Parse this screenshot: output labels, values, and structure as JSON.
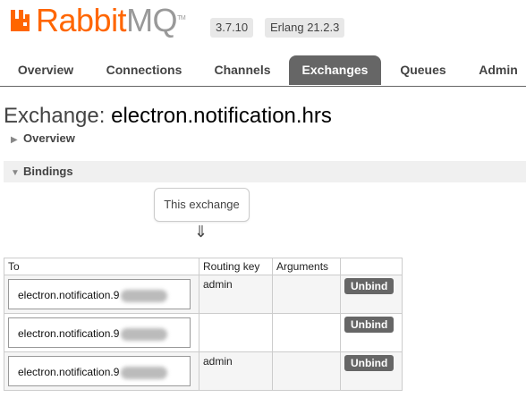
{
  "header": {
    "logo_word_rabbit": "Rabbit",
    "logo_word_mq": "MQ",
    "logo_tm": "TM",
    "version": "3.7.10",
    "erlang": "Erlang 21.2.3"
  },
  "nav": {
    "tabs": [
      "Overview",
      "Connections",
      "Channels",
      "Exchanges",
      "Queues",
      "Admin"
    ],
    "active": "Exchanges"
  },
  "page": {
    "title_prefix": "Exchange:",
    "exchange_name": "electron.notification.hrs"
  },
  "sections": {
    "overview": "Overview",
    "bindings": "Bindings"
  },
  "bindings": {
    "this_exchange": "This exchange",
    "arrow": "⇓",
    "columns": [
      "To",
      "Routing key",
      "Arguments",
      ""
    ],
    "rows": [
      {
        "to": "electron.notification.9",
        "routing_key": "admin",
        "arguments": "",
        "action": "Unbind"
      },
      {
        "to": "electron.notification.9",
        "routing_key": "",
        "arguments": "",
        "action": "Unbind"
      },
      {
        "to": "electron.notification.9",
        "routing_key": "admin",
        "arguments": "",
        "action": "Unbind"
      }
    ]
  },
  "colors": {
    "brand_orange": "#ff6600",
    "tab_active_bg": "#666666",
    "button_bg": "#666666"
  }
}
